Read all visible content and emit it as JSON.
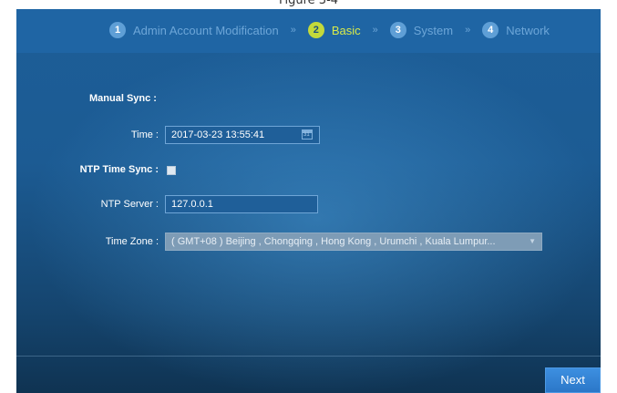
{
  "caption": "Figure 3-4",
  "steps": [
    {
      "num": "1",
      "label": "Admin Account Modification"
    },
    {
      "num": "2",
      "label": "Basic"
    },
    {
      "num": "3",
      "label": "System"
    },
    {
      "num": "4",
      "label": "Network"
    }
  ],
  "separator": "»",
  "active_step": 2,
  "form": {
    "manual_sync_label": "Manual Sync :",
    "time_label": "Time :",
    "time_value": "2017-03-23 13:55:41",
    "ntp_sync_label": "NTP Time Sync :",
    "ntp_sync_checked": false,
    "ntp_server_label": "NTP Server :",
    "ntp_server_value": "127.0.0.1",
    "time_zone_label": "Time Zone :",
    "time_zone_value": "( GMT+08 ) Beijing , Chongqing , Hong Kong , Urumchi , Kuala Lumpur...",
    "time_zone_arrow": "▼"
  },
  "footer": {
    "next_label": "Next"
  },
  "colors": {
    "active_step": "#c3d93b",
    "inactive_step": "#5f9fd6",
    "panel_bg": "#1c5b93",
    "button": "#2b77c8"
  }
}
